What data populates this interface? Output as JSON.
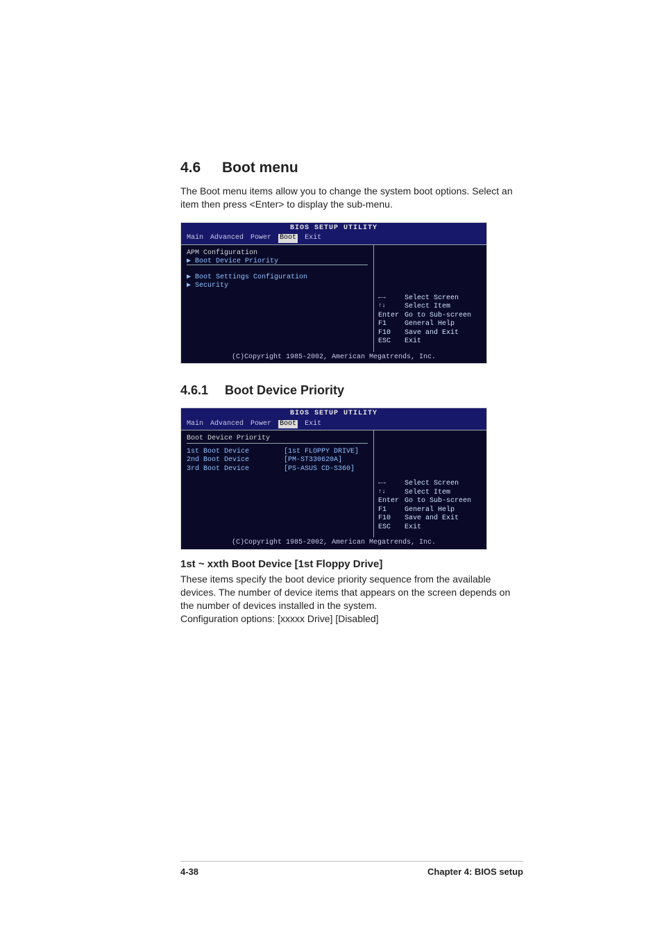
{
  "section": {
    "number": "4.6",
    "title": "Boot menu",
    "description": "The Boot menu items allow you to change the system boot options. Select an item then press <Enter> to display the sub-menu."
  },
  "bios1": {
    "title": "BIOS SETUP UTILITY",
    "tabs": [
      "Main",
      "Advanced",
      "Power",
      "Boot",
      "Exit"
    ],
    "active_tab": "Boot",
    "heading": "APM Configuration",
    "items": [
      "Boot Device Priority",
      "Boot Settings Configuration",
      "Security"
    ],
    "hints": {
      "arrowlr": "Select Screen",
      "arrowud": "Select Item",
      "enter": "Go to Sub-screen",
      "f1": "General Help",
      "f10": "Save and Exit",
      "esc": "Exit"
    },
    "copyright": "(C)Copyright 1985-2002, American Megatrends, Inc."
  },
  "subsection": {
    "number": "4.6.1",
    "title": "Boot Device Priority"
  },
  "bios2": {
    "title": "BIOS SETUP UTILITY",
    "tabs": [
      "Main",
      "Advanced",
      "Power",
      "Boot",
      "Exit"
    ],
    "active_tab": "Boot",
    "heading": "Boot Device Priority",
    "rows": [
      {
        "k": "1st Boot Device",
        "v": "[1st FLOPPY DRIVE]"
      },
      {
        "k": "2nd Boot Device",
        "v": "[PM-ST330620A]"
      },
      {
        "k": "3rd Boot Device",
        "v": "[PS-ASUS CD-S360]"
      }
    ],
    "hints": {
      "arrowlr": "Select Screen",
      "arrowud": "Select Item",
      "enter": "Go to Sub-screen",
      "f1": "General Help",
      "f10": "Save and Exit",
      "esc": "Exit"
    },
    "copyright": "(C)Copyright 1985-2002, American Megatrends, Inc."
  },
  "item": {
    "title": "1st ~ xxth Boot Device [1st Floppy Drive]",
    "desc": "These items specify the boot device priority sequence from the available devices. The number of device items that appears on the screen depends on the number of devices installed in the system.",
    "opts": "Configuration options: [xxxxx Drive] [Disabled]"
  },
  "footer": {
    "page": "4-38",
    "chapter": "Chapter 4: BIOS setup"
  },
  "hint_keys": {
    "enter": "Enter",
    "f1": "F1",
    "f10": "F10",
    "esc": "ESC"
  }
}
